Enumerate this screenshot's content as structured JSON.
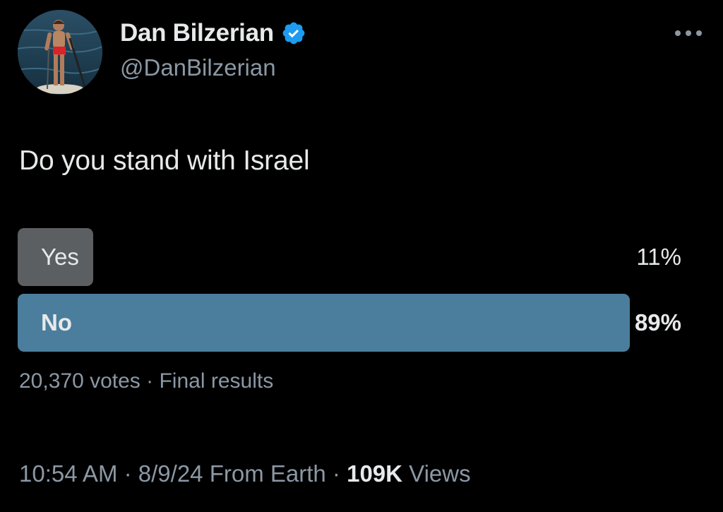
{
  "author": {
    "name": "Dan Bilzerian",
    "handle": "@DanBilzerian",
    "verified": true
  },
  "more_icon": "more-horizontal-icon",
  "tweet": {
    "text": "Do you stand with Israel"
  },
  "poll": {
    "options": [
      {
        "label": "Yes",
        "percent_label": "11%",
        "percent": 11,
        "winner": false
      },
      {
        "label": "No",
        "percent_label": "89%",
        "percent": 89,
        "winner": true
      }
    ],
    "votes": "20,370 votes",
    "separator": "·",
    "status": "Final results"
  },
  "footer": {
    "time": "10:54 AM",
    "date": "8/9/24",
    "source": "From Earth",
    "separator": "·",
    "views_count": "109K",
    "views_label": "Views"
  },
  "colors": {
    "background": "#000000",
    "text_primary": "#e7e9ea",
    "text_secondary": "#8b98a5",
    "verified_badge": "#1d9bf0",
    "poll_winner_bar": "#4a7e9c",
    "poll_loser_bar": "#5c5f62"
  }
}
